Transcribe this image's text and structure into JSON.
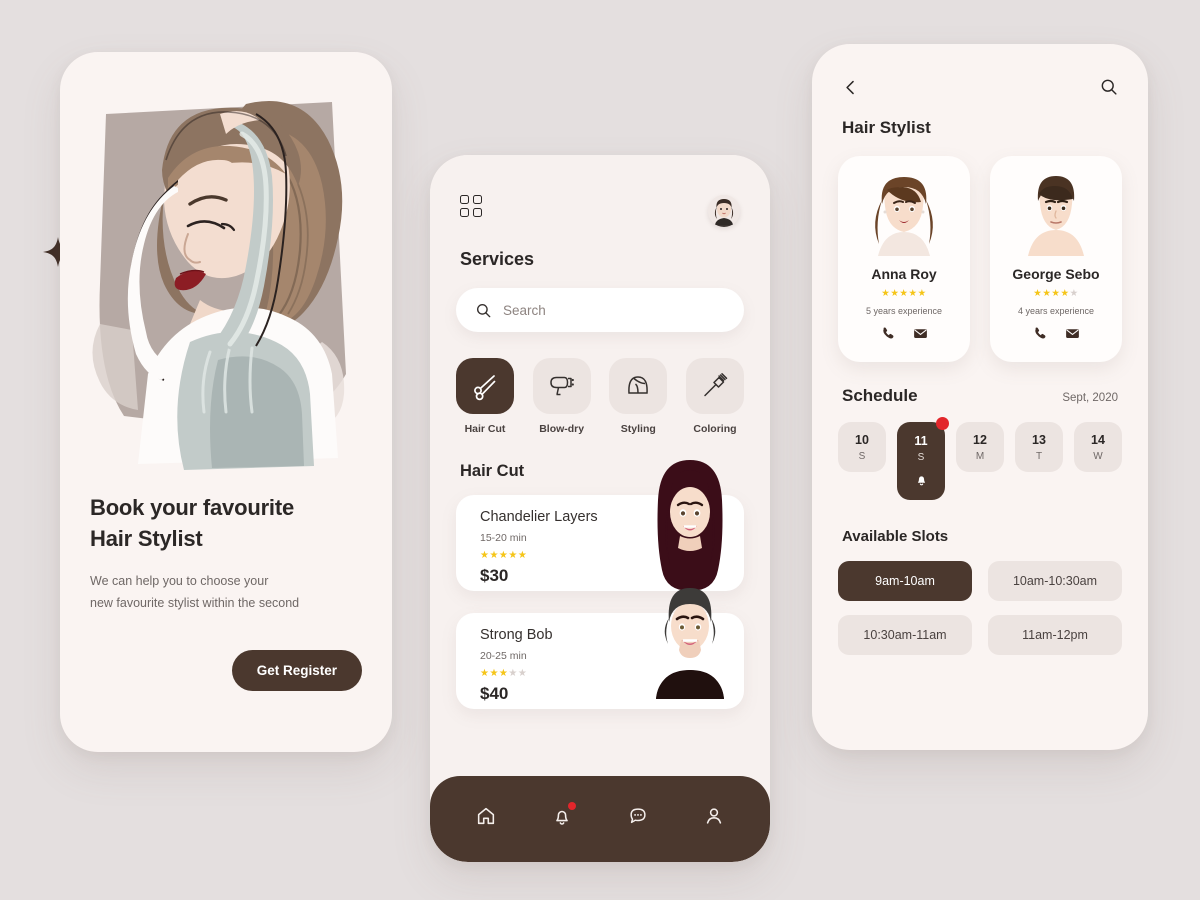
{
  "theme": {
    "page_bg": "#e4dfdf",
    "screen_bg": "#faf4f2",
    "accent_dark": "#4b382e",
    "star_on": "#f5c518",
    "star_off": "#d8d0cd",
    "badge_red": "#e2262b"
  },
  "screen1": {
    "title_line1": "Book your favourite",
    "title_line2": "Hair Stylist",
    "sub_line1": "We can help you to choose your",
    "sub_line2": "new favourite stylist within the second",
    "cta_label": "Get Register",
    "hero_alt": "fashion illustration of woman with raised arms"
  },
  "screen2": {
    "heading": "Services",
    "search_placeholder": "Search",
    "search_value": "",
    "categories": [
      {
        "label": "Hair Cut",
        "icon": "scissors-icon",
        "active": true
      },
      {
        "label": "Blow-dry",
        "icon": "hairdryer-icon",
        "active": false
      },
      {
        "label": "Styling",
        "icon": "styling-head-icon",
        "active": false
      },
      {
        "label": "Coloring",
        "icon": "dye-brush-icon",
        "active": false
      }
    ],
    "section_title": "Hair Cut",
    "services": [
      {
        "name": "Chandelier Layers",
        "duration": "15-20 min",
        "rating": 5,
        "max_rating": 5,
        "price": "$30"
      },
      {
        "name": "Strong Bob",
        "duration": "20-25 min",
        "rating": 3,
        "max_rating": 5,
        "price": "$40"
      }
    ],
    "nav": [
      {
        "icon": "home-icon",
        "badge": false
      },
      {
        "icon": "bell-icon",
        "badge": true
      },
      {
        "icon": "chat-icon",
        "badge": false
      },
      {
        "icon": "person-icon",
        "badge": false
      }
    ]
  },
  "screen3": {
    "title": "Hair Stylist",
    "stylists": [
      {
        "name": "Anna Roy",
        "rating": 5,
        "max_rating": 5,
        "experience": "5 years experience",
        "actions": [
          "phone-icon",
          "mail-icon"
        ]
      },
      {
        "name": "George Sebo",
        "rating": 4,
        "max_rating": 5,
        "experience": "4 years experience",
        "actions": [
          "phone-icon",
          "mail-icon"
        ]
      }
    ],
    "schedule_title": "Schedule",
    "month": "Sept, 2020",
    "days": [
      {
        "num": "10",
        "dow": "S",
        "active": false,
        "badge": false
      },
      {
        "num": "11",
        "dow": "S",
        "active": true,
        "badge": true
      },
      {
        "num": "12",
        "dow": "M",
        "active": false,
        "badge": false
      },
      {
        "num": "13",
        "dow": "T",
        "active": false,
        "badge": false
      },
      {
        "num": "14",
        "dow": "W",
        "active": false,
        "badge": false
      }
    ],
    "slots_title": "Available Slots",
    "slots": [
      {
        "label": "9am-10am",
        "active": true
      },
      {
        "label": "10am-10:30am",
        "active": false
      },
      {
        "label": "10:30am-11am",
        "active": false
      },
      {
        "label": "11am-12pm",
        "active": false
      }
    ]
  }
}
